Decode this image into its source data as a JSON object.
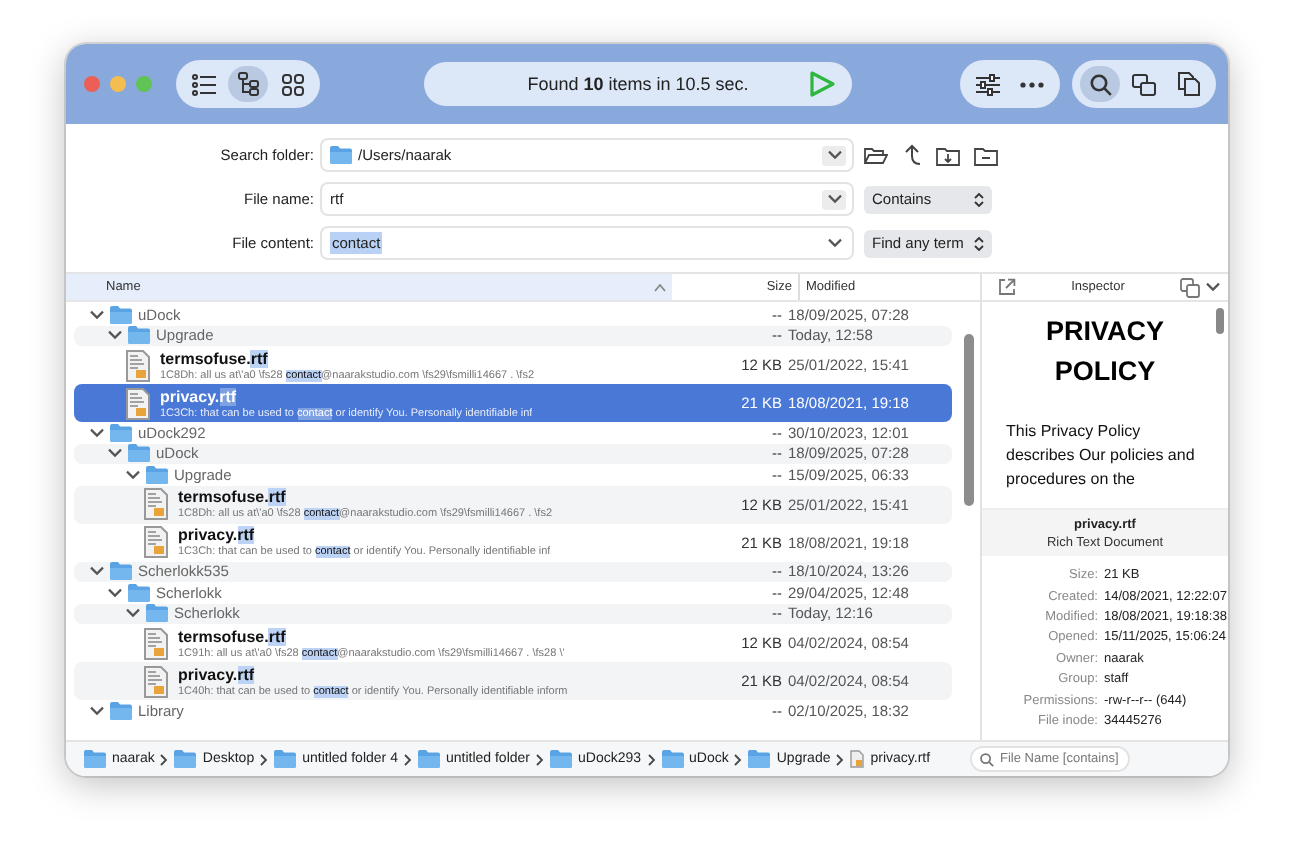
{
  "toolbar": {
    "view_modes": [
      {
        "kind": "list",
        "selected": false
      },
      {
        "kind": "tree",
        "selected": true
      },
      {
        "kind": "grid",
        "selected": false
      }
    ],
    "status": "Found **10** items in 10.5 sec.",
    "tools": [
      {
        "kind": "filter",
        "selected": false
      },
      {
        "kind": "more",
        "selected": false
      }
    ],
    "panels": [
      {
        "kind": "search",
        "selected": true
      },
      {
        "kind": "compare",
        "selected": false
      },
      {
        "kind": "copy",
        "selected": false
      }
    ]
  },
  "search_form": {
    "fields": [
      {
        "kind": "folder",
        "label": "Search folder:",
        "value": "/Users/naarak",
        "highlighted": false
      },
      {
        "kind": "text",
        "label": "File name:",
        "value": "rtf",
        "mode": "Contains",
        "highlighted": false
      },
      {
        "kind": "content",
        "label": "File content:",
        "value": "contact",
        "mode": "Find any term",
        "highlighted": true
      }
    ]
  },
  "results": {
    "columns": [
      {
        "label": "Name",
        "sorted": true
      },
      {
        "label": "Size",
        "sorted": false
      },
      {
        "label": "Modified",
        "sorted": false
      }
    ],
    "rows": [
      {
        "kind": "folder",
        "name": "uDock",
        "size": "--",
        "modified": "18/09/2025, 07:28",
        "expanded": true,
        "children": [
          {
            "kind": "folder",
            "name": "Upgrade",
            "size": "--",
            "modified": "Today, 12:58",
            "expanded": true,
            "children": [
              {
                "kind": "file",
                "name": "termsofuse.",
                "match": "rtf",
                "snippet_start": "1C8Dh: all us at\\'a0 \\fs28 ",
                "snippet_match": "contact",
                "snippet_end": "@naarakstudio.com \\fs29\\fsmilli14667 . \\fs2",
                "size": "12 KB",
                "modified": "25/01/2022, 15:41",
                "selected": false
              },
              {
                "kind": "file",
                "name": "privacy.",
                "match": "rtf",
                "snippet_start": "1C3Ch: that can be used to ",
                "snippet_match": "contact",
                "snippet_end": " or identify You. Personally identifiable inf",
                "size": "21 KB",
                "modified": "18/08/2021, 19:18",
                "selected": true
              }
            ]
          }
        ]
      },
      {
        "kind": "folder",
        "name": "uDock292",
        "size": "--",
        "modified": "30/10/2023, 12:01",
        "expanded": true,
        "children": [
          {
            "kind": "folder",
            "name": "uDock",
            "size": "--",
            "modified": "18/09/2025, 07:28",
            "expanded": true,
            "children": [
              {
                "kind": "folder",
                "name": "Upgrade",
                "size": "--",
                "modified": "15/09/2025, 06:33",
                "expanded": true,
                "children": [
                  {
                    "kind": "file",
                    "name": "termsofuse.",
                    "match": "rtf",
                    "snippet_start": "1C8Dh: all us at\\'a0 \\fs28 ",
                    "snippet_match": "contact",
                    "snippet_end": "@naarakstudio.com \\fs29\\fsmilli14667 . \\fs2",
                    "size": "12 KB",
                    "modified": "25/01/2022, 15:41",
                    "selected": false
                  },
                  {
                    "kind": "file",
                    "name": "privacy.",
                    "match": "rtf",
                    "snippet_start": "1C3Ch: that can be used to ",
                    "snippet_match": "contact",
                    "snippet_end": " or identify You. Personally identifiable inf",
                    "size": "21 KB",
                    "modified": "18/08/2021, 19:18",
                    "selected": false
                  }
                ]
              }
            ]
          }
        ]
      },
      {
        "kind": "folder",
        "name": "Scherlokk535",
        "size": "--",
        "modified": "18/10/2024, 13:26",
        "expanded": true,
        "children": [
          {
            "kind": "folder",
            "name": "Scherlokk",
            "size": "--",
            "modified": "29/04/2025, 12:48",
            "expanded": true,
            "children": [
              {
                "kind": "folder",
                "name": "Scherlokk",
                "size": "--",
                "modified": "Today, 12:16",
                "expanded": true,
                "children": [
                  {
                    "kind": "file",
                    "name": "termsofuse.",
                    "match": "rtf",
                    "snippet_start": "1C91h: all us at\\'a0 \\fs28 ",
                    "snippet_match": "contact",
                    "snippet_end": "@naarakstudio.com \\fs29\\fsmilli14667 . \\fs28 \\'",
                    "size": "12 KB",
                    "modified": "04/02/2024, 08:54",
                    "selected": false
                  },
                  {
                    "kind": "file",
                    "name": "privacy.",
                    "match": "rtf",
                    "snippet_start": "1C40h: that can be used to ",
                    "snippet_match": "contact",
                    "snippet_end": " or identify You. Personally identifiable inform",
                    "size": "21 KB",
                    "modified": "04/02/2024, 08:54",
                    "selected": false
                  }
                ]
              }
            ]
          }
        ]
      },
      {
        "kind": "folder",
        "name": "Library",
        "size": "--",
        "modified": "02/10/2025, 18:32",
        "expanded": true
      }
    ]
  },
  "inspector": {
    "title": "Inspector",
    "preview": {
      "heading": "PRIVACY POLICY",
      "paragraph": "This Privacy Policy describes Our policies and procedures on the"
    },
    "file_name": "privacy.rtf",
    "file_type": "Rich Text Document",
    "properties": [
      {
        "label": "Size:",
        "value": "21 KB"
      },
      {
        "label": "Created:",
        "value": "14/08/2021, 12:22:07"
      },
      {
        "label": "Modified:",
        "value": "18/08/2021, 19:18:38"
      },
      {
        "label": "Opened:",
        "value": "15/11/2025, 15:06:24"
      },
      {
        "label": "Owner:",
        "value": "naarak"
      },
      {
        "label": "Group:",
        "value": "staff"
      },
      {
        "label": "Permissions:",
        "value": "-rw-r--r-- (644)"
      },
      {
        "label": "File inode:",
        "value": "34445276"
      }
    ]
  },
  "path_bar": {
    "path": [
      {
        "kind": "folder",
        "name": "naarak"
      },
      {
        "kind": "folder",
        "name": "Desktop"
      },
      {
        "kind": "folder",
        "name": "untitled folder 4"
      },
      {
        "kind": "folder",
        "name": "untitled folder"
      },
      {
        "kind": "folder",
        "name": "uDock293"
      },
      {
        "kind": "folder",
        "name": "uDock"
      },
      {
        "kind": "folder",
        "name": "Upgrade"
      },
      {
        "kind": "file",
        "name": "privacy.rtf"
      }
    ],
    "filter": {
      "placeholder": "File Name [contains]"
    }
  }
}
